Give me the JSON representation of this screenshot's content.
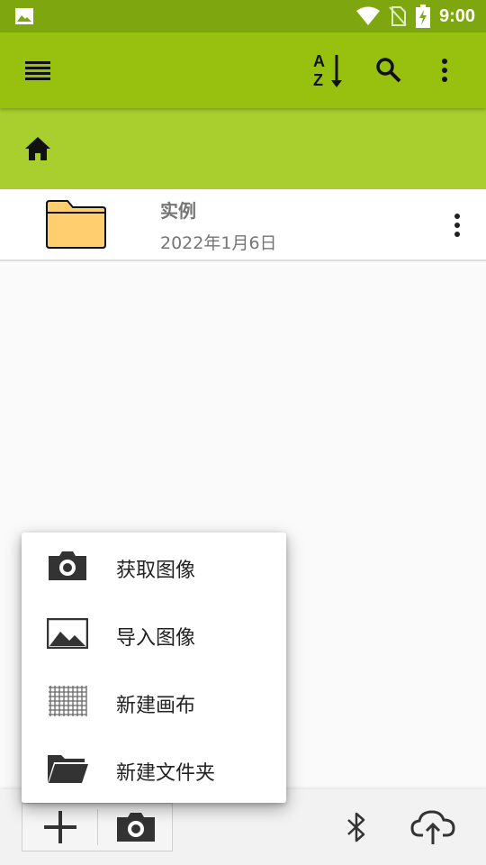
{
  "status_bar": {
    "time": "9:00",
    "icons": [
      "gallery-icon",
      "wifi-icon",
      "no-sim-icon",
      "battery-charging-icon"
    ]
  },
  "app_bar": {
    "icons": [
      "list-menu-icon",
      "sort-az-icon",
      "search-icon",
      "more-vert-icon"
    ]
  },
  "breadcrumb": {
    "icon": "home-icon"
  },
  "files": [
    {
      "name": "实例",
      "date": "2022年1月6日",
      "icon": "folder-icon"
    }
  ],
  "popup_menu": {
    "items": [
      {
        "label": "获取图像",
        "icon": "camera-icon"
      },
      {
        "label": "导入图像",
        "icon": "image-icon"
      },
      {
        "label": "新建画布",
        "icon": "grid-canvas-icon"
      },
      {
        "label": "新建文件夹",
        "icon": "folder-open-icon"
      }
    ]
  },
  "bottom_bar": {
    "icons": [
      "add-icon",
      "camera-icon",
      "bluetooth-icon",
      "cloud-upload-icon"
    ]
  },
  "colors": {
    "status_bar": "#7ea70f",
    "app_bar": "#98c10f",
    "breadcrumb_bar": "#a8cf2d",
    "folder": "#ffcf6f"
  }
}
